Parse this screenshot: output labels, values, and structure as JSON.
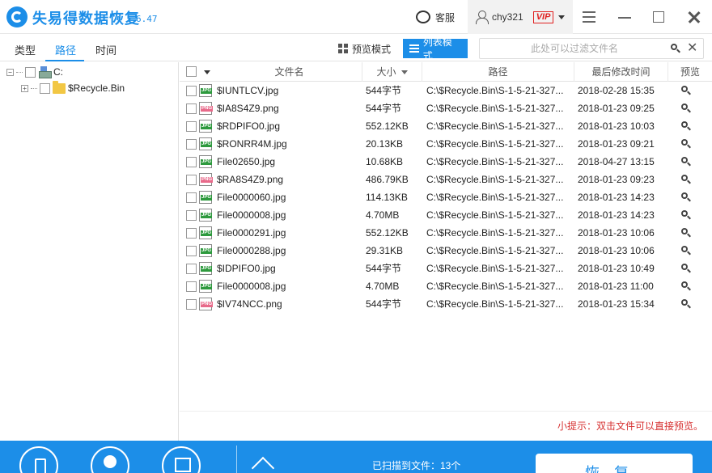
{
  "app": {
    "title": "失易得数据恢复",
    "version": "6.47"
  },
  "header": {
    "service_label": "客服",
    "username": "chy321",
    "vip_badge": "VIP"
  },
  "tabs": [
    {
      "label": "类型",
      "active": false
    },
    {
      "label": "路径",
      "active": true
    },
    {
      "label": "时间",
      "active": false
    }
  ],
  "view_modes": {
    "preview": "预览模式",
    "list": "列表模式",
    "active": "list"
  },
  "search": {
    "placeholder": "此处可以过滤文件名",
    "value": ""
  },
  "tree": {
    "root": {
      "label": "C:",
      "expander": "−"
    },
    "children": [
      {
        "label": "$Recycle.Bin",
        "expander": "+"
      }
    ]
  },
  "table": {
    "columns": [
      "文件名",
      "大小",
      "路径",
      "最后修改时间",
      "预览"
    ],
    "sort_column": "大小",
    "rows": [
      {
        "name": "$IUNTLCV.jpg",
        "type": "jpg",
        "size": "544字节",
        "path": "C:\\$Recycle.Bin\\S-1-5-21-327...",
        "modified": "2018-02-28  15:35"
      },
      {
        "name": "$IA8S4Z9.png",
        "type": "png",
        "size": "544字节",
        "path": "C:\\$Recycle.Bin\\S-1-5-21-327...",
        "modified": "2018-01-23  09:25"
      },
      {
        "name": "$RDPIFO0.jpg",
        "type": "jpg",
        "size": "552.12KB",
        "path": "C:\\$Recycle.Bin\\S-1-5-21-327...",
        "modified": "2018-01-23  10:03"
      },
      {
        "name": "$RONRR4M.jpg",
        "type": "jpg",
        "size": "20.13KB",
        "path": "C:\\$Recycle.Bin\\S-1-5-21-327...",
        "modified": "2018-01-23  09:21"
      },
      {
        "name": "File02650.jpg",
        "type": "jpg",
        "size": "10.68KB",
        "path": "C:\\$Recycle.Bin\\S-1-5-21-327...",
        "modified": "2018-04-27  13:15"
      },
      {
        "name": "$RA8S4Z9.png",
        "type": "png",
        "size": "486.79KB",
        "path": "C:\\$Recycle.Bin\\S-1-5-21-327...",
        "modified": "2018-01-23  09:23"
      },
      {
        "name": "File0000060.jpg",
        "type": "jpg",
        "size": "114.13KB",
        "path": "C:\\$Recycle.Bin\\S-1-5-21-327...",
        "modified": "2018-01-23  14:23"
      },
      {
        "name": "File0000008.jpg",
        "type": "jpg",
        "size": "4.70MB",
        "path": "C:\\$Recycle.Bin\\S-1-5-21-327...",
        "modified": "2018-01-23  14:23"
      },
      {
        "name": "File0000291.jpg",
        "type": "jpg",
        "size": "552.12KB",
        "path": "C:\\$Recycle.Bin\\S-1-5-21-327...",
        "modified": "2018-01-23  10:06"
      },
      {
        "name": "File0000288.jpg",
        "type": "jpg",
        "size": "29.31KB",
        "path": "C:\\$Recycle.Bin\\S-1-5-21-327...",
        "modified": "2018-01-23  10:06"
      },
      {
        "name": "$IDPIFO0.jpg",
        "type": "jpg",
        "size": "544字节",
        "path": "C:\\$Recycle.Bin\\S-1-5-21-327...",
        "modified": "2018-01-23  10:49"
      },
      {
        "name": "File0000008.jpg",
        "type": "jpg",
        "size": "4.70MB",
        "path": "C:\\$Recycle.Bin\\S-1-5-21-327...",
        "modified": "2018-01-23  11:00"
      },
      {
        "name": "$IV74NCC.png",
        "type": "png",
        "size": "544字节",
        "path": "C:\\$Recycle.Bin\\S-1-5-21-327...",
        "modified": "2018-01-23  15:34"
      }
    ]
  },
  "hint": "小提示：双击文件可以直接预览。",
  "footer": {
    "status": "已扫描到文件：13个",
    "recover_label": "恢复"
  },
  "colors": {
    "accent": "#1c8ee8",
    "hint": "#d63030",
    "vip": "#e02020"
  }
}
